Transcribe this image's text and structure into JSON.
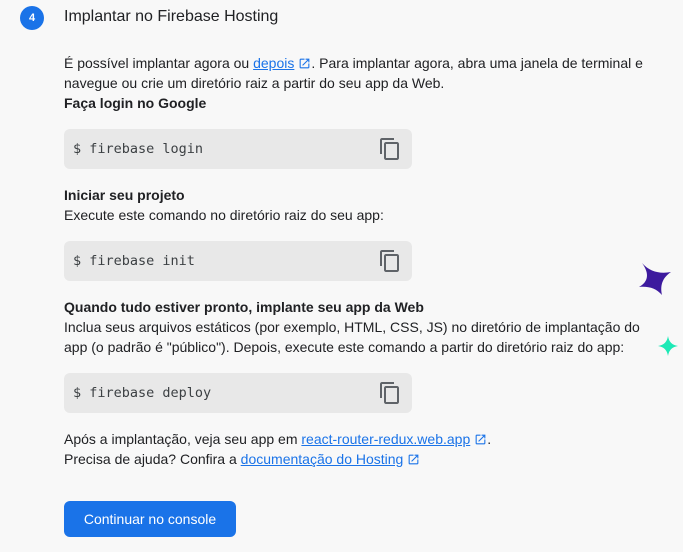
{
  "step": {
    "number": "4",
    "title": "Implantar no Firebase Hosting"
  },
  "intro": {
    "text_before": "É possível implantar agora ou ",
    "link_later": "depois",
    "text_after": ". Para implantar agora, abra uma janela de terminal e navegue ou crie um diretório raiz a partir do seu app da Web."
  },
  "login": {
    "heading": "Faça login no Google",
    "command": "$ firebase login"
  },
  "init": {
    "heading": "Iniciar seu projeto",
    "description": "Execute este comando no diretório raiz do seu app:",
    "command": "$ firebase init"
  },
  "deploy": {
    "heading": "Quando tudo estiver pronto, implante seu app da Web",
    "description": "Inclua seus arquivos estáticos (por exemplo, HTML, CSS, JS) no diretório de implantação do app (o padrão é \"público\"). Depois, execute este comando a partir do diretório raiz do app:",
    "command": "$ firebase deploy"
  },
  "after": {
    "text_before": "Após a implantação, veja seu app em ",
    "app_link": "react-router-redux.web.app",
    "text_after": "."
  },
  "help": {
    "text_before": "Precisa de ajuda? Confira a ",
    "docs_link": "documentação do Hosting"
  },
  "continue_button": "Continuar no console",
  "colors": {
    "accent": "#1a73e8",
    "sparkle_purple": "#3d1a9e",
    "sparkle_teal": "#1de9b6"
  },
  "icons": {
    "copy": "copy-icon",
    "external": "open-in-new-icon"
  }
}
